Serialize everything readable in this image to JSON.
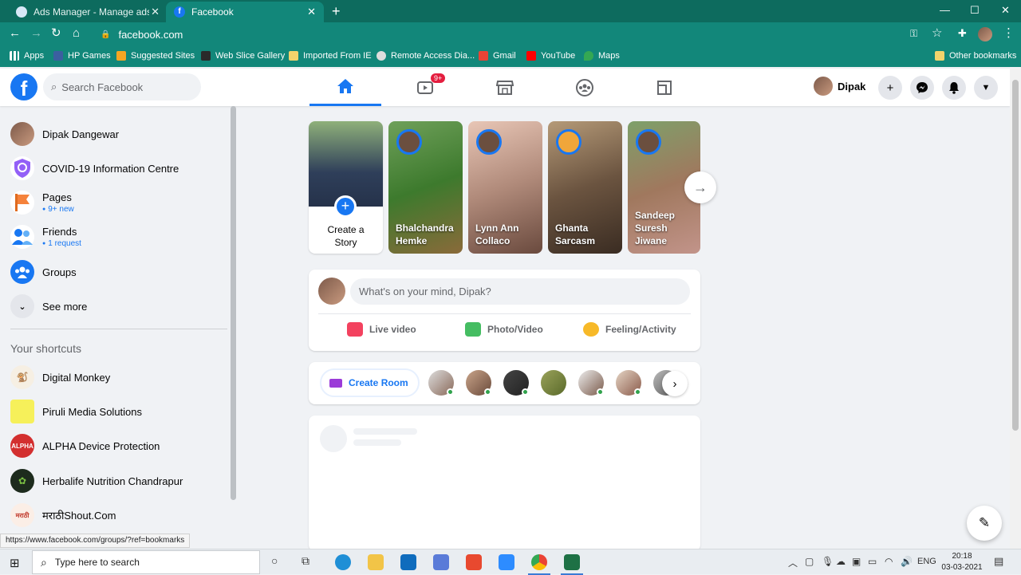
{
  "browser": {
    "tabs": [
      {
        "title": "Ads Manager - Manage ads - Ca",
        "active": false
      },
      {
        "title": "Facebook",
        "active": true
      }
    ],
    "url": "facebook.com",
    "bookmarks": [
      "Apps",
      "HP Games",
      "Suggested Sites",
      "Web Slice Gallery",
      "Imported From IE",
      "Remote Access Dia...",
      "Gmail",
      "YouTube",
      "Maps"
    ],
    "other_bookmarks": "Other bookmarks",
    "status_url": "https://www.facebook.com/groups/?ref=bookmarks"
  },
  "fb": {
    "search_placeholder": "Search Facebook",
    "watch_badge": "9+",
    "profile_name": "Dipak"
  },
  "sidebar": {
    "items": [
      {
        "label": "Dipak Dangewar",
        "sub": ""
      },
      {
        "label": "COVID-19 Information Centre",
        "sub": ""
      },
      {
        "label": "Pages",
        "sub": "9+ new"
      },
      {
        "label": "Friends",
        "sub": "1 request"
      },
      {
        "label": "Groups",
        "sub": ""
      },
      {
        "label": "See more",
        "sub": ""
      }
    ],
    "shortcuts_heading": "Your shortcuts",
    "shortcuts": [
      "Digital Monkey",
      "Piruli Media Solutions",
      "ALPHA Device Protection",
      "Herbalife Nutrition Chandrapur",
      "मराठीShout.Com"
    ]
  },
  "stories": {
    "create_label": "Create a Story",
    "items": [
      {
        "name": "Bhalchandra Hemke"
      },
      {
        "name": "Lynn Ann Collaco"
      },
      {
        "name": "Ghanta Sarcasm"
      },
      {
        "name": "Sandeep Suresh Jiwane"
      }
    ]
  },
  "composer": {
    "placeholder": "What's on your mind, Dipak?",
    "actions": [
      "Live video",
      "Photo/Video",
      "Feeling/Activity"
    ]
  },
  "rooms": {
    "create_label": "Create Room"
  },
  "taskbar": {
    "search_placeholder": "Type here to search",
    "language": "ENG",
    "time": "20:18",
    "date": "03-03-2021"
  }
}
